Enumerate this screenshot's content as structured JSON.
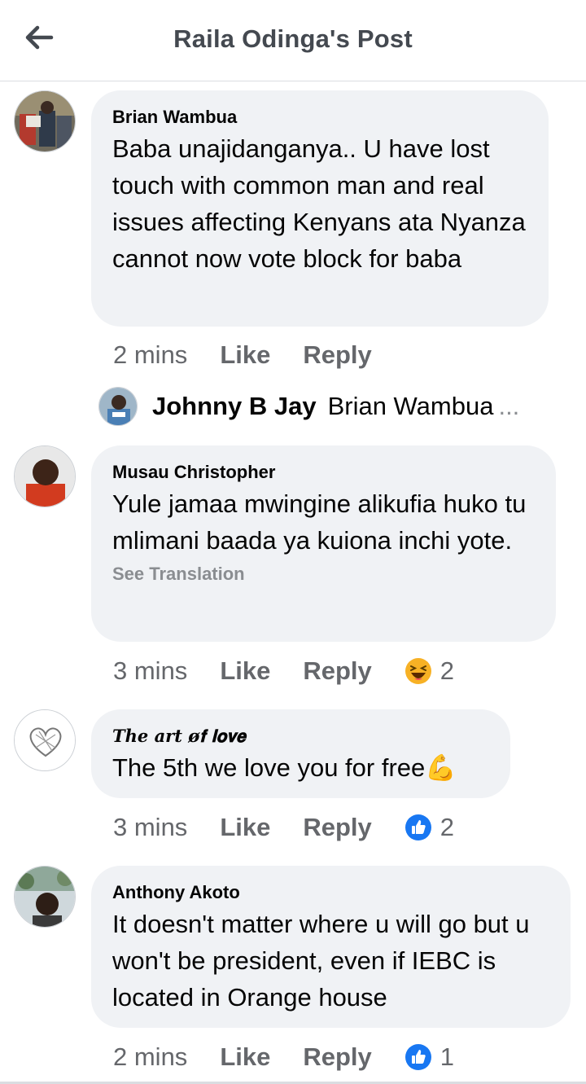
{
  "header": {
    "title": "Raila Odinga's Post",
    "back_icon": "arrow-left-icon"
  },
  "comments": [
    {
      "author": "Brian Wambua",
      "text": "Baba unajidanganya.. U have lost touch with common man and real issues affecting Kenyans ata Nyanza cannot now vote block for baba",
      "time": "2 mins",
      "like": "Like",
      "reply": "Reply"
    },
    {
      "author": "Musau Christopher",
      "text": "Yule jamaa mwingine alikufia huko tu mlimani baada ya kuiona inchi yote.",
      "see_translation": "See Translation",
      "time": "3 mins",
      "like": "Like",
      "reply": "Reply",
      "reaction": {
        "icon": "laughing-emoji-icon",
        "count": "2"
      }
    },
    {
      "author": "𝑻𝒉𝒆 𝒂𝒓𝒕 ø𝐟 𝐥𝐨𝐯𝐞",
      "text": "The 5th we love you for free💪",
      "time": "3 mins",
      "like": "Like",
      "reply": "Reply",
      "reaction": {
        "icon": "like-thumb-icon",
        "count": "2"
      }
    },
    {
      "author": "Anthony Akoto",
      "text": "It doesn't matter where u will go but u won't be president, even if IEBC is located in Orange house",
      "time": "2 mins",
      "like": "Like",
      "reply": "Reply",
      "reaction": {
        "icon": "like-thumb-icon",
        "count": "1"
      }
    }
  ],
  "reply_preview": {
    "name": "Johnny B Jay",
    "text": "Brian Wambua",
    "ellipsis": "..."
  },
  "colors": {
    "bubble": "#f0f2f5",
    "meta_text": "#65676b",
    "like_blue": "#1877f2",
    "emoji_yellow": "#f7b125"
  }
}
